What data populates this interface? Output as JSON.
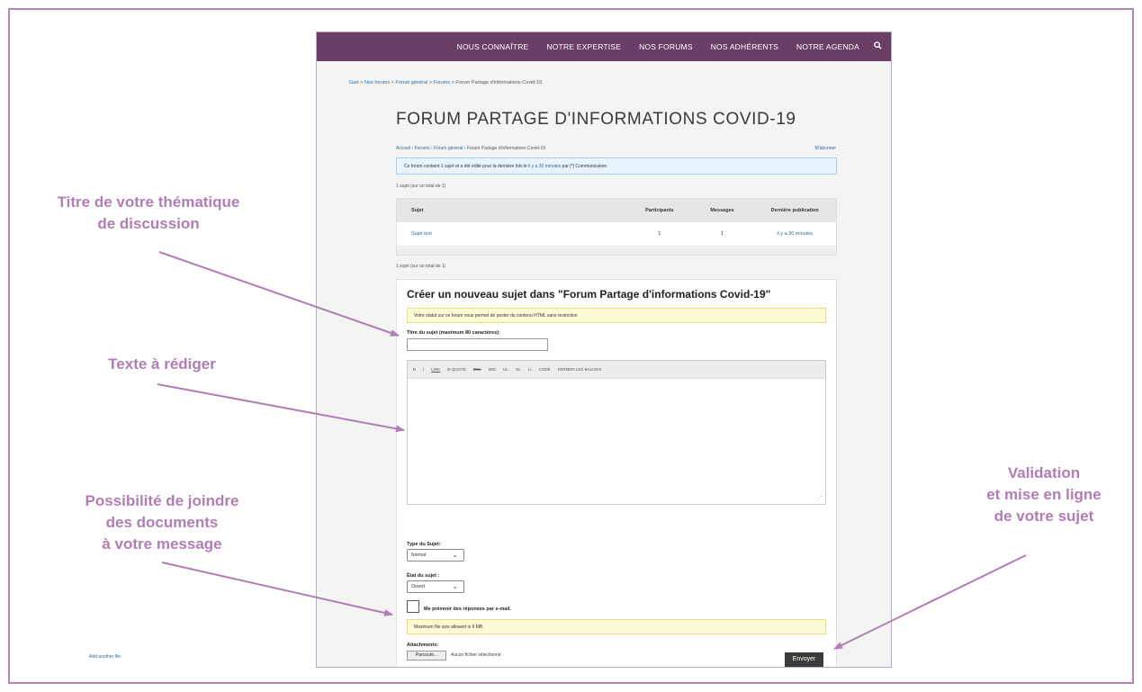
{
  "callouts": {
    "title_topic": [
      "Titre de votre thématique",
      "de discussion"
    ],
    "text_write": [
      "Texte à rédiger"
    ],
    "attach_docs": [
      "Possibilité de joindre",
      "des documents",
      "à votre message"
    ],
    "validation": [
      "Validation",
      "et mise en ligne",
      "de votre sujet"
    ]
  },
  "nav": {
    "items": [
      "NOUS CONNAÎTRE",
      "NOTRE EXPERTISE",
      "NOS FORUMS",
      "NOS ADHÉRENTS",
      "NOTRE AGENDA"
    ],
    "search_icon": "search-icon"
  },
  "breadcrumb_top": {
    "items": [
      "Gart",
      "Nos forums",
      "Forum général",
      "Forums",
      "Forum Partage d'informations Covid-19"
    ],
    "sep": " > "
  },
  "page_title": "FORUM PARTAGE D'INFORMATIONS COVID-19",
  "breadcrumb_forum": {
    "items": [
      "Accueil",
      "Forums",
      "Forum général",
      "Forum Partage d'informations Covid-19"
    ],
    "sep": " › "
  },
  "subscribe": "M'abonner",
  "forum_info": {
    "before": "Ce forum contient 1 sujet et a été édité pour la dernière fois le ",
    "link": "il y a 30 minutes",
    "after": " par [*] Communication."
  },
  "topic_count": "1 sujet (sur un total de 1)",
  "table": {
    "headers": [
      "Sujet",
      "Participants",
      "Messages",
      "Dernière publication"
    ],
    "rows": [
      {
        "subject": "Sujet test",
        "participants": "1",
        "messages": "1",
        "last": "il y a 30 minutes"
      }
    ]
  },
  "form": {
    "title": "Créer un nouveau sujet dans \"Forum Partage d'informations Covid-19\"",
    "html_notice": "Votre statut sur ce forum vous permet de poster du contenu HTML sans restriction",
    "title_label": "Titre du sujet (maximum 80 caractères):",
    "toolbar": [
      "B",
      "I",
      "LINK",
      "B-QUOTE",
      "DEL",
      "IMG",
      "UL",
      "OL",
      "LI",
      "CODE",
      "FERMER LES BALISES"
    ],
    "type_label": "Type du Sujet:",
    "type_value": "Normal",
    "state_label": "État du sujet :",
    "state_value": "Ouvert",
    "notify_label": "Me prévenir des réponses par e-mail.",
    "max_file": "Maximum file size allowed is 9 MB.",
    "attachments_label": "Attachments:",
    "browse": "Parcourir...",
    "no_file": "Aucun fichier sélectionné.",
    "add_file": "Add another file",
    "submit": "Envoyer"
  }
}
